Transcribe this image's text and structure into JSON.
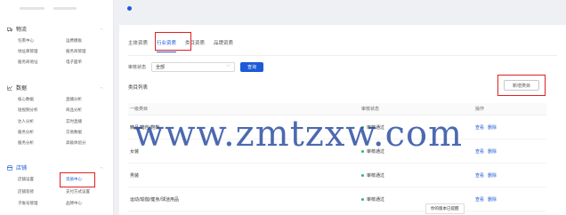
{
  "top_notice": "",
  "sidebar": {
    "groups": [
      {
        "title": "物流",
        "items": [
          "包裹中心",
          "运费模板",
          "地址库管理",
          "服务商管理",
          "服务商地址",
          "电子面单"
        ]
      },
      {
        "title": "数据",
        "items": [
          "核心数据",
          "直播分析",
          "短视频分析",
          "商品分析",
          "达人分析",
          "实时直播",
          "服务分析",
          "交易数据",
          "服务分析",
          "高级体验分"
        ]
      },
      {
        "title": "店铺",
        "items": [
          "店铺设置",
          "资质中心",
          "店铺装修",
          "支付方式设置",
          "子账号管理",
          "品牌中心"
        ]
      }
    ]
  },
  "tabs": [
    {
      "label": "主体资质"
    },
    {
      "label": "行业资质"
    },
    {
      "label": "类目资质"
    },
    {
      "label": "品牌资质"
    }
  ],
  "filter": {
    "label": "审核状态",
    "value": "全部",
    "query_label": "查询"
  },
  "list": {
    "title": "类目列表",
    "new_label": "新增类目",
    "columns": [
      "一级类目",
      "审核状态",
      "操作"
    ],
    "rows": [
      {
        "category": "精品/箱包/鞋靴",
        "status": "审核通过",
        "view": "查看",
        "delete": "删除"
      },
      {
        "category": "女装",
        "status": "审核通过",
        "view": "查看",
        "delete": "删除"
      },
      {
        "category": "男装",
        "status": "审核通过",
        "view": "查看",
        "delete": "删除"
      },
      {
        "category": "运动/瑜伽/健身/球迷用品",
        "status": "审核通过",
        "view": "查看",
        "delete": "删除"
      }
    ]
  },
  "watermark": "www.zmtzxw.com",
  "tooltip": "你的版本已提醒",
  "colors": {
    "accent": "#1e5ad7",
    "highlight_box": "#e02020",
    "status_ok": "#35b36b"
  }
}
